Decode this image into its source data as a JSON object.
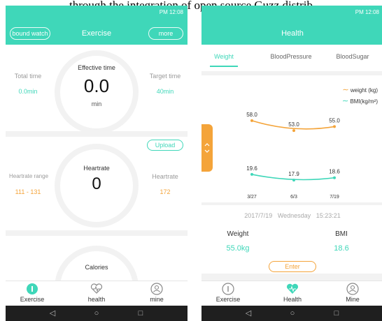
{
  "caption": "through the integration of open source Guzz distrib",
  "left": {
    "status_text": "PM 12:08",
    "header": {
      "title": "Exercise",
      "left_button": "bound watch",
      "right_button": "more"
    },
    "effective": {
      "label": "Effective time",
      "value": "0.0",
      "unit": "min"
    },
    "total_time": {
      "label": "Total time",
      "value": "0.0min"
    },
    "target_time": {
      "label": "Target time",
      "value": "40min"
    },
    "upload_label": "Upload",
    "heartrate": {
      "label": "Heartrate",
      "value": "0"
    },
    "heartrate_range": {
      "label": "Heartrate range",
      "value": "111 - 131"
    },
    "heartrate_right": {
      "label": "Heartrate",
      "value": "172"
    },
    "calories": {
      "label": "Calories"
    },
    "tabs": [
      {
        "label": "Exercise",
        "icon": "exercise-icon",
        "active": true
      },
      {
        "label": "health",
        "icon": "heart-icon",
        "active": false
      },
      {
        "label": "mine",
        "icon": "user-icon",
        "active": false
      }
    ]
  },
  "right": {
    "status_text": "PM 12:08",
    "header": {
      "title": "Health"
    },
    "subtabs": [
      "Weight",
      "BloodPressure",
      "BloodSugar"
    ],
    "legend": {
      "weight": "weight (kg)",
      "bmi": "BMI(kg/m²)"
    },
    "chart_data": {
      "type": "line",
      "x": [
        "3/27",
        "6/3",
        "7/19"
      ],
      "series": [
        {
          "name": "weight (kg)",
          "values": [
            58.0,
            53.0,
            55.0
          ],
          "labels": [
            "58.0",
            "53.0",
            "55.0"
          ],
          "color": "#f4a43a"
        },
        {
          "name": "BMI(kg/m²)",
          "values": [
            19.6,
            17.9,
            18.6
          ],
          "labels": [
            "19.6",
            "17.9",
            "18.6"
          ],
          "color": "#3fd7b9"
        }
      ]
    },
    "record": {
      "date": "2017/7/19",
      "weekday": "Wednesday",
      "time": "15:23:21",
      "weight_label": "Weight",
      "weight_value": "55.0kg",
      "bmi_label": "BMI",
      "bmi_value": "18.6",
      "enter_label": "Enter"
    },
    "tabs": [
      {
        "label": "Exercise",
        "icon": "exercise-icon",
        "active": false
      },
      {
        "label": "Health",
        "icon": "heart-icon",
        "active": true
      },
      {
        "label": "Mine",
        "icon": "user-icon",
        "active": false
      }
    ]
  },
  "colors": {
    "accent": "#3fd7b9",
    "orange": "#f4a43a",
    "navbar": "#1f1f1f"
  },
  "nav_icons": [
    "back-icon",
    "home-icon",
    "recents-icon"
  ]
}
